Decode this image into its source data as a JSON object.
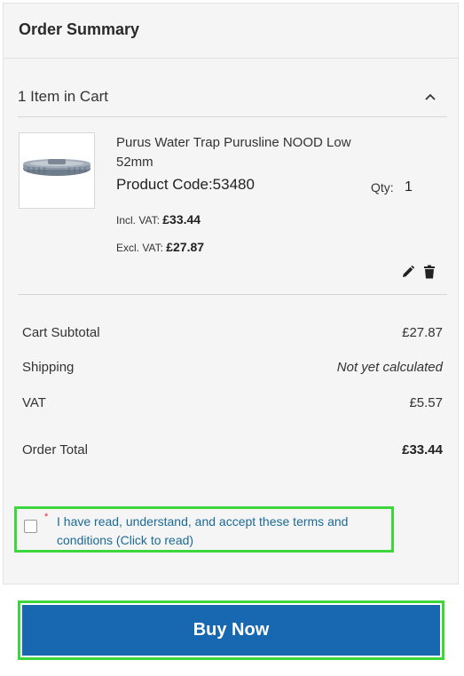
{
  "summary": {
    "title": "Order Summary",
    "cart_count_label": "1 Item in Cart"
  },
  "item": {
    "name": "Purus Water Trap Purusline NOOD Low 52mm",
    "product_code": "Product Code:53480",
    "qty_label": "Qty:",
    "qty_value": "1",
    "incl_vat_label": "Incl. VAT:",
    "incl_vat_price": "£33.44",
    "excl_vat_label": "Excl. VAT:",
    "excl_vat_price": "£27.87",
    "image_icon": "product-thumbnail"
  },
  "totals": [
    {
      "label": "Cart Subtotal",
      "value": "£27.87"
    },
    {
      "label": "Shipping",
      "value": "Not yet calculated"
    },
    {
      "label": "VAT",
      "value": "£5.57"
    },
    {
      "label": "Order Total",
      "value": "£33.44"
    }
  ],
  "terms": {
    "required_mark": "*",
    "text": "I have read, understand, and accept these terms and conditions (Click to read)",
    "checked": false
  },
  "actions": {
    "buy_label": "Buy Now"
  },
  "colors": {
    "accent": "#1768b1",
    "link": "#1c6a95",
    "highlight": "#3dd63d",
    "required": "#e02b27"
  },
  "icons": [
    "chevron-up-icon",
    "pencil-icon",
    "trash-icon"
  ]
}
